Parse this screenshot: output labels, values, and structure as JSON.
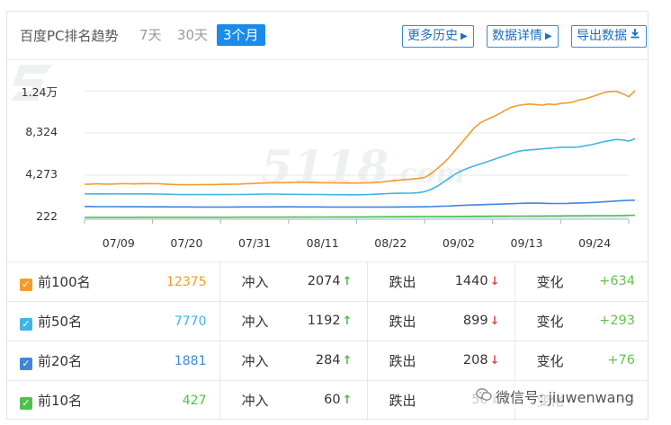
{
  "header": {
    "title": "百度PC排名趋势",
    "ranges": [
      "7天",
      "30天",
      "3个月"
    ],
    "buttons": {
      "history": "更多历史",
      "detail": "数据详情",
      "export": "导出数据"
    }
  },
  "watermark": {
    "text": "5118",
    "suffix": ".com"
  },
  "chart_data": {
    "type": "line",
    "x": [
      "06/28",
      "06/29",
      "06/30",
      "07/01",
      "07/02",
      "07/03",
      "07/04",
      "07/05",
      "07/06",
      "07/07",
      "07/08",
      "07/09",
      "07/10",
      "07/11",
      "07/12",
      "07/13",
      "07/14",
      "07/15",
      "07/16",
      "07/17",
      "07/18",
      "07/19",
      "07/20",
      "07/21",
      "07/22",
      "07/23",
      "07/24",
      "07/25",
      "07/26",
      "07/27",
      "07/28",
      "07/29",
      "07/30",
      "07/31",
      "08/01",
      "08/02",
      "08/03",
      "08/04",
      "08/05",
      "08/06",
      "08/07",
      "08/08",
      "08/09",
      "08/10",
      "08/11",
      "08/12",
      "08/13",
      "08/14",
      "08/15",
      "08/16",
      "08/17",
      "08/18",
      "08/19",
      "08/20",
      "08/21",
      "08/22",
      "08/23",
      "08/24",
      "08/25",
      "08/26",
      "08/27",
      "08/28",
      "08/29",
      "08/30",
      "08/31",
      "09/01",
      "09/02",
      "09/03",
      "09/04",
      "09/05",
      "09/06",
      "09/07",
      "09/08",
      "09/09",
      "09/10",
      "09/11",
      "09/12",
      "09/13",
      "09/14",
      "09/15",
      "09/16",
      "09/17",
      "09/18",
      "09/19",
      "09/20",
      "09/21",
      "09/22",
      "09/23",
      "09/24"
    ],
    "series": [
      {
        "color": "#f59b2a",
        "values": [
          3400,
          3420,
          3450,
          3430,
          3420,
          3440,
          3460,
          3450,
          3440,
          3460,
          3470,
          3460,
          3450,
          3420,
          3390,
          3370,
          3360,
          3360,
          3370,
          3370,
          3380,
          3380,
          3390,
          3400,
          3410,
          3420,
          3450,
          3470,
          3500,
          3520,
          3540,
          3560,
          3560,
          3570,
          3580,
          3590,
          3580,
          3570,
          3560,
          3550,
          3540,
          3530,
          3520,
          3520,
          3520,
          3530,
          3540,
          3570,
          3620,
          3690,
          3750,
          3810,
          3860,
          3900,
          3960,
          4050,
          4400,
          4900,
          5400,
          6000,
          6700,
          7400,
          8100,
          8800,
          9300,
          9600,
          9850,
          10150,
          10500,
          10800,
          10950,
          11050,
          11100,
          11050,
          11000,
          11100,
          11050,
          11150,
          11200,
          11300,
          11500,
          11600,
          11800,
          12000,
          12200,
          12300,
          12320,
          12100,
          11800,
          12375
        ]
      },
      {
        "color": "#3fb5e6",
        "values": [
          2490,
          2480,
          2490,
          2480,
          2480,
          2490,
          2480,
          2490,
          2480,
          2480,
          2480,
          2470,
          2460,
          2450,
          2440,
          2420,
          2410,
          2410,
          2410,
          2410,
          2410,
          2410,
          2410,
          2410,
          2420,
          2420,
          2430,
          2440,
          2450,
          2460,
          2460,
          2460,
          2450,
          2440,
          2440,
          2430,
          2430,
          2420,
          2420,
          2410,
          2400,
          2400,
          2400,
          2390,
          2390,
          2400,
          2420,
          2450,
          2480,
          2510,
          2530,
          2540,
          2550,
          2560,
          2600,
          2700,
          2900,
          3200,
          3600,
          4000,
          4400,
          4700,
          4950,
          5150,
          5350,
          5550,
          5750,
          5950,
          6150,
          6350,
          6550,
          6650,
          6700,
          6750,
          6800,
          6850,
          6900,
          6950,
          6950,
          6950,
          7000,
          7100,
          7200,
          7350,
          7500,
          7600,
          7700,
          7650,
          7550,
          7770
        ]
      },
      {
        "color": "#3f86dc",
        "values": [
          1270,
          1270,
          1260,
          1260,
          1260,
          1260,
          1250,
          1250,
          1250,
          1250,
          1240,
          1240,
          1240,
          1240,
          1230,
          1230,
          1230,
          1230,
          1220,
          1220,
          1220,
          1220,
          1220,
          1220,
          1220,
          1230,
          1230,
          1230,
          1230,
          1230,
          1230,
          1240,
          1240,
          1240,
          1240,
          1230,
          1230,
          1230,
          1230,
          1220,
          1220,
          1220,
          1220,
          1220,
          1220,
          1220,
          1220,
          1220,
          1220,
          1220,
          1220,
          1230,
          1230,
          1230,
          1240,
          1250,
          1260,
          1280,
          1300,
          1320,
          1350,
          1380,
          1400,
          1420,
          1440,
          1460,
          1480,
          1500,
          1520,
          1540,
          1560,
          1580,
          1590,
          1590,
          1580,
          1570,
          1560,
          1560,
          1570,
          1590,
          1610,
          1630,
          1650,
          1680,
          1720,
          1760,
          1800,
          1830,
          1860,
          1881
        ]
      },
      {
        "color": "#4cc24c",
        "values": [
          230,
          230,
          230,
          232,
          232,
          233,
          233,
          234,
          234,
          235,
          235,
          235,
          236,
          236,
          237,
          237,
          238,
          238,
          239,
          239,
          240,
          240,
          241,
          242,
          243,
          244,
          245,
          246,
          247,
          248,
          249,
          250,
          252,
          254,
          256,
          258,
          260,
          262,
          264,
          266,
          268,
          270,
          272,
          274,
          276,
          278,
          280,
          282,
          285,
          288,
          291,
          294,
          297,
          300,
          303,
          306,
          309,
          312,
          315,
          318,
          321,
          324,
          327,
          330,
          333,
          336,
          339,
          342,
          345,
          348,
          351,
          354,
          357,
          360,
          363,
          366,
          369,
          372,
          375,
          378,
          381,
          384,
          387,
          390,
          395,
          400,
          405,
          410,
          418,
          427
        ]
      }
    ],
    "yticks": [
      {
        "value": 222,
        "label": "222"
      },
      {
        "value": 4273,
        "label": "4,273"
      },
      {
        "value": 8324,
        "label": "8,324"
      },
      {
        "value": 12375,
        "label": "1.24万"
      }
    ],
    "xticks": [
      "07/09",
      "07/20",
      "07/31",
      "08/11",
      "08/22",
      "09/02",
      "09/13",
      "09/24"
    ],
    "xlabel": "",
    "ylabel": "",
    "grid": true
  },
  "stats": [
    {
      "name": "前100名",
      "color": "#f59b2a",
      "count": "12375",
      "surge_label": "冲入",
      "surge": "2074",
      "drop_label": "跌出",
      "drop": "1440",
      "change_label": "变化",
      "change": "+634"
    },
    {
      "name": "前50名",
      "color": "#3fb5e6",
      "count": "7770",
      "surge_label": "冲入",
      "surge": "1192",
      "drop_label": "跌出",
      "drop": "899",
      "change_label": "变化",
      "change": "+293"
    },
    {
      "name": "前20名",
      "color": "#3f86dc",
      "count": "1881",
      "surge_label": "冲入",
      "surge": "284",
      "drop_label": "跌出",
      "drop": "208",
      "change_label": "变化",
      "change": "+76"
    },
    {
      "name": "前10名",
      "color": "#4cc24c",
      "count": "427",
      "surge_label": "冲入",
      "surge": "60",
      "drop_label": "跌出",
      "drop": "56",
      "change_label": "变化",
      "change": "+4"
    }
  ],
  "overlay": {
    "wechat_text": "微信号: jiuwenwang"
  }
}
